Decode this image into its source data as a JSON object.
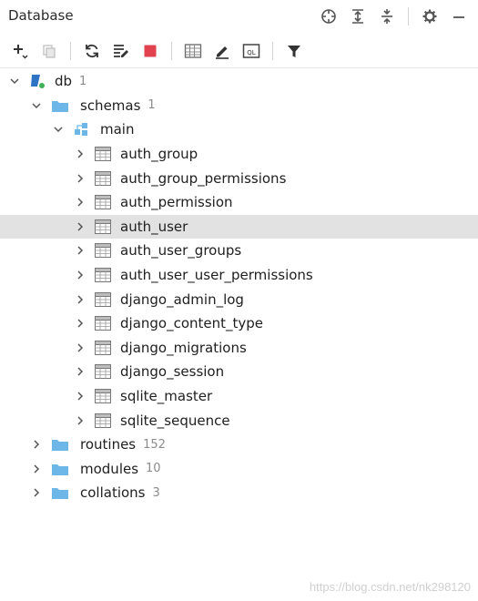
{
  "window": {
    "title": "Database"
  },
  "tree": {
    "root": {
      "label": "db",
      "count": "1"
    },
    "schemas": {
      "label": "schemas",
      "count": "1"
    },
    "main": {
      "label": "main"
    },
    "tables": [
      "auth_group",
      "auth_group_permissions",
      "auth_permission",
      "auth_user",
      "auth_user_groups",
      "auth_user_user_permissions",
      "django_admin_log",
      "django_content_type",
      "django_migrations",
      "django_session",
      "sqlite_master",
      "sqlite_sequence"
    ],
    "selected_table": "auth_user",
    "routines": {
      "label": "routines",
      "count": "152"
    },
    "modules": {
      "label": "modules",
      "count": "10"
    },
    "collations": {
      "label": "collations",
      "count": "3"
    }
  },
  "watermark": "https://blog.csdn.net/nk298120",
  "colors": {
    "folder": "#6cb6e8",
    "db_blue": "#2e74c4",
    "db_green": "#3fb257",
    "stop_red": "#e0424f"
  }
}
